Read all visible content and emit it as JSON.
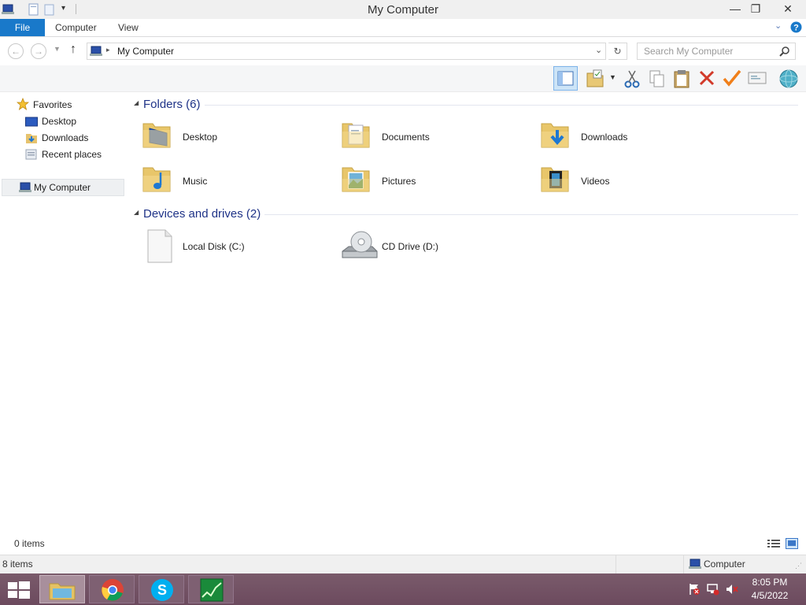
{
  "window": {
    "title": "My Computer"
  },
  "ribbon": {
    "tabs": [
      "File",
      "Computer",
      "View"
    ]
  },
  "address": {
    "path": "My Computer",
    "search_placeholder": "Search My Computer"
  },
  "nav": {
    "favorites_label": "Favorites",
    "favorites": [
      "Desktop",
      "Downloads",
      "Recent places"
    ],
    "computer_label": "My Computer"
  },
  "content": {
    "folders_header": "Folders (6)",
    "folders": [
      "Desktop",
      "Documents",
      "Downloads",
      "Music",
      "Pictures",
      "Videos"
    ],
    "drives_header": "Devices and drives (2)",
    "drives": [
      "Local Disk (C:)",
      "CD Drive (D:)"
    ]
  },
  "status": {
    "selection": "0 items",
    "count": "8 items",
    "location": "Computer"
  },
  "taskbar": {
    "time": "8:05 PM",
    "date": "4/5/2022"
  },
  "colors": {
    "accent": "#1979ca",
    "group_header": "#1e3287",
    "taskbar": "#6c4a5e"
  }
}
